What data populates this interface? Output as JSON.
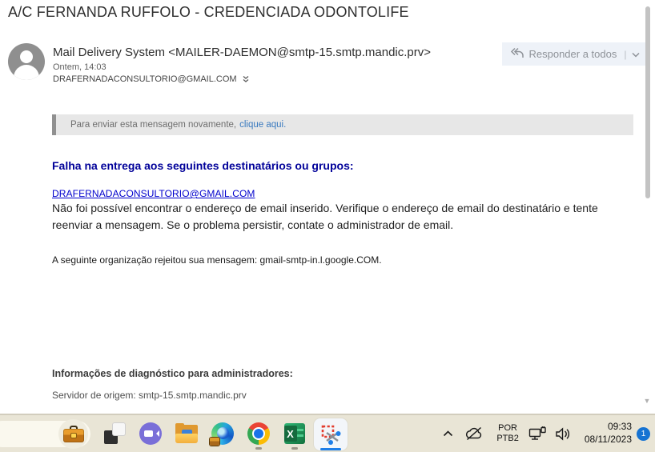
{
  "email": {
    "subject": "A/C FERNANDA RUFFOLO - CREDENCIADA ODONTOLIFE",
    "sender": "Mail Delivery System <MAILER-DAEMON@smtp-15.smtp.mandic.prv>",
    "timestamp": "Ontem, 14:03",
    "recipient": "DRAFERNADACONSULTORIO@GMAIL.COM",
    "reply_all_label": "Responder a todos",
    "resend_notice": "Para enviar esta mensagem novamente,",
    "resend_link": "clique aqui.",
    "failure_heading": "Falha na entrega aos seguintes destinatários ou grupos:",
    "failed_recipient_link": "DRAFERNADACONSULTORIO@GMAIL.COM",
    "failure_body": "Não foi possível encontrar o endereço de email inserido. Verifique o endereço de email do destinatário e tente reenviar a mensagem. Se o problema persistir, contate o administrador de email.",
    "rejection_line": "A seguinte organização rejeitou sua mensagem: gmail-smtp-in.l.google.COM.",
    "diagnostics_heading": "Informações de diagnóstico para administradores:",
    "origin_server": "Servidor de origem: smtp-15.smtp.mandic.prv"
  },
  "taskbar": {
    "language": {
      "line1": "POR",
      "line2": "PTB2"
    },
    "clock": {
      "time": "09:33",
      "date": "08/11/2023"
    },
    "notification_count": "1",
    "excel_letter": "X",
    "icons": {
      "briefcase": "orange briefcase pill button",
      "task-view": "overlapping squares",
      "video-meeting": "purple circle with camera",
      "file-explorer": "yellow folder",
      "edge": "edge browser with work badge",
      "chrome": "chrome browser",
      "excel": "excel green X",
      "snipping-tool": "red dashed selection with scissors (active)"
    }
  },
  "colors": {
    "accent_navy": "#000099",
    "body_link_blue": "#0000cd",
    "notice_link_blue": "#3a7abf",
    "badge_blue": "#1673d2",
    "taskbar_bg": "#e9e5d6",
    "active_underline": "#1f7fe8"
  }
}
